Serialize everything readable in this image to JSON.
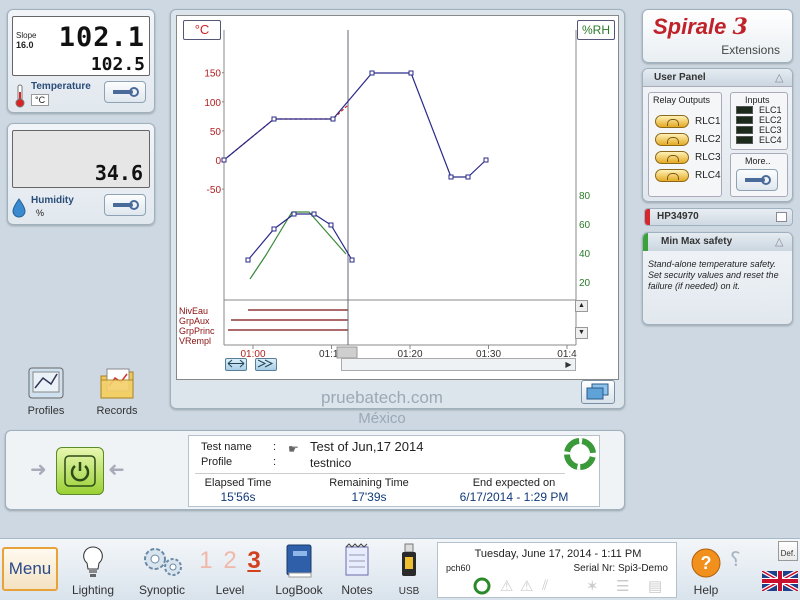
{
  "temperature_panel": {
    "slope_label": "Slope",
    "slope_value": "16.0",
    "current_value": "102.1",
    "setpoint_value": "102.5",
    "name": "Temperature",
    "unit": "°C"
  },
  "humidity_panel": {
    "value": "34.6",
    "name": "Humidity",
    "unit": "%"
  },
  "graph": {
    "left_unit_button": "°C",
    "right_unit_button": "%RH",
    "temp_axis_ticks": [
      "150",
      "100",
      "50",
      "0",
      "-50"
    ],
    "rh_axis_ticks": [
      "80",
      "60",
      "40",
      "20"
    ],
    "time_ticks": [
      "01:00",
      "01:10",
      "01:20",
      "01:30",
      "01:4"
    ],
    "digital_channels": [
      "NivEau",
      "GrpAux",
      "GrpPrinc",
      "VRempl"
    ],
    "nav_left_label": "<=>",
    "nav_right_label": ">><"
  },
  "chart_data": {
    "type": "line",
    "xlabel": "",
    "ylabel": "",
    "x_ticks": [
      "01:00",
      "01:10",
      "01:20",
      "01:30",
      "01:4"
    ],
    "series": [
      {
        "axis": "°C",
        "color": "#2a2a8a",
        "points": [
          [
            0,
            0
          ],
          [
            3.3,
            70
          ],
          [
            7.5,
            70
          ],
          [
            10,
            150
          ],
          [
            13,
            150
          ],
          [
            15.8,
            -30
          ],
          [
            17.2,
            -30
          ],
          [
            18.2,
            0
          ]
        ]
      },
      {
        "axis": "%RH",
        "color": "#2a2a8a",
        "points": [
          [
            -0.5,
            30
          ],
          [
            1.5,
            58
          ],
          [
            3,
            66
          ],
          [
            4.4,
            66
          ],
          [
            6,
            55
          ],
          [
            7.2,
            30
          ]
        ]
      },
      {
        "axis": "%RH",
        "color": "#3a8a3a",
        "points": [
          [
            -0.5,
            18
          ],
          [
            1,
            38
          ],
          [
            3,
            65
          ],
          [
            4.6,
            65
          ],
          [
            7,
            35
          ]
        ]
      }
    ],
    "temp_range": [
      -50,
      150
    ],
    "rh_range": [
      20,
      80
    ],
    "cursor_time": "01:10"
  },
  "brand": {
    "name": "Spirale",
    "version": "3",
    "subtitle": "Extensions"
  },
  "user_panel": {
    "title": "User Panel",
    "relay_outputs_label": "Relay Outputs",
    "relays": [
      "RLC1",
      "RLC2",
      "RLC3",
      "RLC4"
    ],
    "inputs_label": "Inputs",
    "inputs": [
      "ELC1",
      "ELC2",
      "ELC3",
      "ELC4"
    ],
    "more_label": "More.."
  },
  "hp_panel": {
    "title": "HP34970"
  },
  "minmax_panel": {
    "title": "Min Max safety",
    "description": "Stand-alone temperature safety. Set security values and reset the failure (if needed) on it."
  },
  "shortcuts": {
    "profiles_label": "Profiles",
    "records_label": "Records"
  },
  "watermark": {
    "line1": "pruebatech.com",
    "line2": "México"
  },
  "test_info": {
    "test_name_label": "Test name",
    "test_name_value": "Test of Jun,17 2014",
    "profile_label": "Profile",
    "profile_value": "testnico",
    "elapsed_label": "Elapsed Time",
    "elapsed_value": "15'56s",
    "remaining_label": "Remaining Time",
    "remaining_value": "17'39s",
    "end_label": "End expected on",
    "end_value": "6/17/2014 - 1:29 PM"
  },
  "toolbar": {
    "menu_label": "Menu",
    "lighting_label": "Lighting",
    "synoptic_label": "Synoptic",
    "level_label": "Level",
    "level_numbers": [
      "1",
      "2",
      "3"
    ],
    "logbook_label": "LogBook",
    "notes_label": "Notes",
    "usb_label": "USB",
    "help_label": "Help",
    "def_label": "Def."
  },
  "status": {
    "datetime": "Tuesday, June 17, 2014 - 1:11 PM",
    "station": "pch60",
    "serial": "Serial Nr: Spi3-Demo"
  }
}
